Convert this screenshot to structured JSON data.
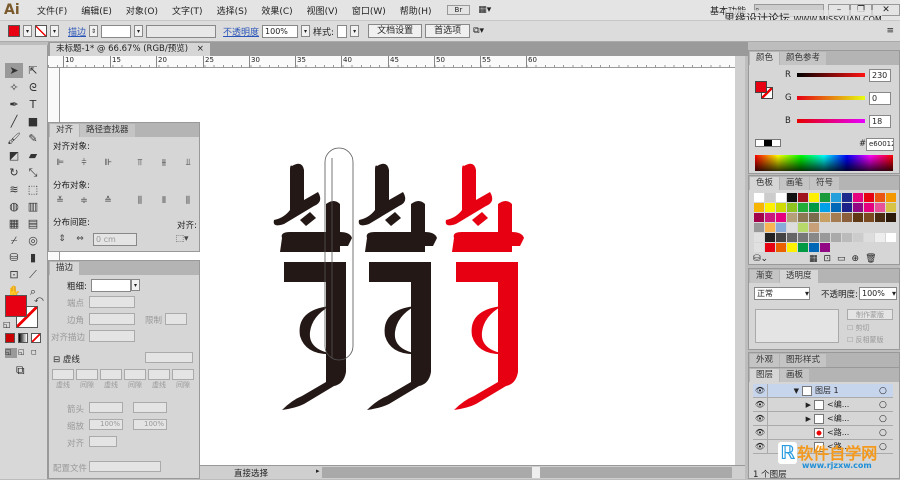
{
  "app": {
    "logo": "Ai",
    "workspace": "基本功能",
    "search_icon": "search-icon",
    "watermark": "思缘设计论坛",
    "watermark_url": "WWW.MISSYUAN.COM"
  },
  "menu": [
    "文件(F)",
    "编辑(E)",
    "对象(O)",
    "文字(T)",
    "选择(S)",
    "效果(C)",
    "视图(V)",
    "窗口(W)",
    "帮助(H)"
  ],
  "menu_extra": {
    "bridge": "Br"
  },
  "control": {
    "fill_color": "#e60012",
    "stroke_label": "描边",
    "stroke_value": "",
    "opacity_label": "不透明度",
    "opacity_value": "100%",
    "style_label": "样式:",
    "doc_setup": "文档设置",
    "prefs": "首选项"
  },
  "document": {
    "tab_title": "未标题-1* @ 66.67% (RGB/预览)",
    "close": "×",
    "ruler_labels": [
      "10",
      "15",
      "20",
      "25",
      "30",
      "35",
      "40",
      "45",
      "50",
      "55",
      "60"
    ]
  },
  "align_panel": {
    "tabs": [
      "对齐",
      "路径查找器"
    ],
    "align_objects": "对齐对象:",
    "distribute_objects": "分布对象:",
    "distribute_spacing": "分布间距:",
    "spacing_value": "0 cm",
    "align_to": "对齐:"
  },
  "stroke_panel": {
    "tab": "描边",
    "weight_label": "粗细:",
    "cap_label": "端点",
    "corner_label": "边角",
    "limit_label": "限制",
    "align_stroke_label": "对齐描边",
    "dashed_label": "虚线",
    "dash_labels": [
      "虚线",
      "间隙",
      "虚线",
      "间隙",
      "虚线",
      "间隙"
    ],
    "arrow_label": "箭头",
    "scale_label": "缩放",
    "scale1": "100%",
    "scale2": "100%",
    "align_label": "对齐",
    "profile_label": "配置文件"
  },
  "color_panel": {
    "tabs": [
      "颜色",
      "颜色参考"
    ],
    "r_label": "R",
    "g_label": "G",
    "b_label": "B",
    "r": "230",
    "g": "0",
    "b": "18",
    "hex_label": "#",
    "hex": "e60012"
  },
  "swatch_panel": {
    "tabs": [
      "色板",
      "画笔",
      "符号"
    ]
  },
  "transparency_panel": {
    "tabs": [
      "渐变",
      "透明度"
    ],
    "blend_mode": "正常",
    "opacity_label": "不透明度:",
    "opacity": "100%",
    "make_mask": "制作蒙版",
    "clip": "剪切",
    "invert": "反相蒙版"
  },
  "appearance_tabs": [
    "外观",
    "图形样式"
  ],
  "layers_panel": {
    "tabs": [
      "图层",
      "画板"
    ],
    "rows": [
      {
        "name": "图层 1"
      },
      {
        "name": "<编..."
      },
      {
        "name": "<编..."
      },
      {
        "name": "<路..."
      },
      {
        "name": "<路..."
      }
    ],
    "count": "1 个图层"
  },
  "status": {
    "tool": "直接选择"
  },
  "corner_watermark": {
    "text": "软件自学网",
    "url": "www.rjzxw.com"
  },
  "colors": {
    "accent": "#e60012",
    "glyph_dark": "#231815"
  }
}
